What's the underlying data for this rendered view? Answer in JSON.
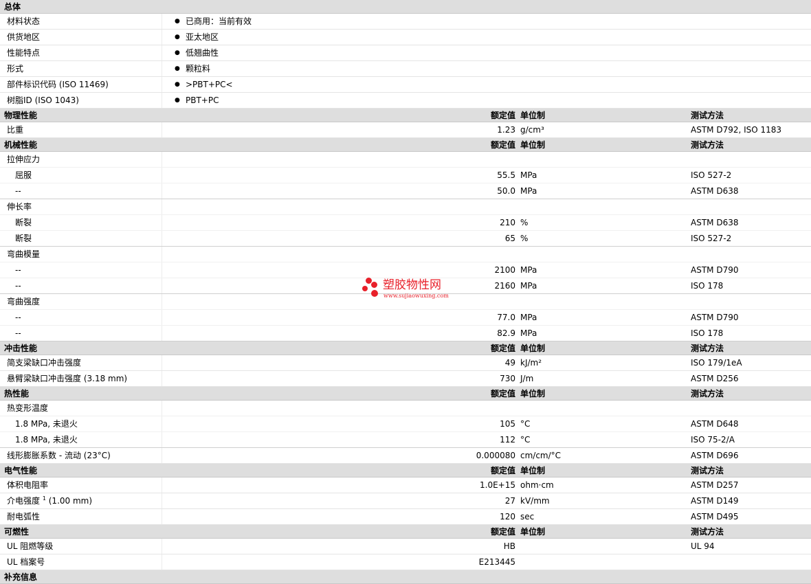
{
  "sections": {
    "general": {
      "title": "总体",
      "rows": [
        {
          "label": "材料状态",
          "value": "已商用：当前有效"
        },
        {
          "label": "供货地区",
          "value": "亚太地区"
        },
        {
          "label": "性能特点",
          "value": "低翘曲性"
        },
        {
          "label": "形式",
          "value": "颗粒料"
        },
        {
          "label": "部件标识代码  (ISO 11469)",
          "value": ">PBT+PC<"
        },
        {
          "label": "树脂ID (ISO 1043)",
          "value": "PBT+PC"
        }
      ]
    },
    "headers": {
      "nominal": "额定值",
      "unit": "单位制",
      "method": "测试方法"
    },
    "physical": {
      "title": "物理性能",
      "rows": [
        {
          "label": "比重",
          "nominal": "1.23",
          "unit": "g/cm³",
          "method": "ASTM D792, ISO 1183"
        }
      ]
    },
    "mechanical": {
      "title": "机械性能",
      "tensile": {
        "label": "拉伸应力",
        "rows": [
          {
            "label": "屈服",
            "nominal": "55.5",
            "unit": "MPa",
            "method": "ISO 527-2"
          },
          {
            "label": "--",
            "nominal": "50.0",
            "unit": "MPa",
            "method": "ASTM D638"
          }
        ]
      },
      "elongation": {
        "label": "伸长率",
        "rows": [
          {
            "label": "断裂",
            "nominal": "210",
            "unit": "%",
            "method": "ASTM D638"
          },
          {
            "label": "断裂",
            "nominal": "65",
            "unit": "%",
            "method": "ISO 527-2"
          }
        ]
      },
      "flex_modulus": {
        "label": "弯曲模量",
        "rows": [
          {
            "label": "--",
            "nominal": "2100",
            "unit": "MPa",
            "method": "ASTM D790"
          },
          {
            "label": "--",
            "nominal": "2160",
            "unit": "MPa",
            "method": "ISO 178"
          }
        ]
      },
      "flex_strength": {
        "label": "弯曲强度",
        "rows": [
          {
            "label": "--",
            "nominal": "77.0",
            "unit": "MPa",
            "method": "ASTM D790"
          },
          {
            "label": "--",
            "nominal": "82.9",
            "unit": "MPa",
            "method": "ISO 178"
          }
        ]
      }
    },
    "impact": {
      "title": "冲击性能",
      "rows": [
        {
          "label": "简支梁缺口冲击强度",
          "nominal": "49",
          "unit": "kJ/m²",
          "method": "ISO 179/1eA"
        },
        {
          "label": "悬臂梁缺口冲击强度  (3.18 mm)",
          "nominal": "730",
          "unit": "J/m",
          "method": "ASTM D256"
        }
      ]
    },
    "thermal": {
      "title": "热性能",
      "hdt": {
        "label": "热变形温度",
        "rows": [
          {
            "label": "1.8 MPa, 未退火",
            "nominal": "105",
            "unit": "°C",
            "method": "ASTM D648"
          },
          {
            "label": "1.8 MPa, 未退火",
            "nominal": "112",
            "unit": "°C",
            "method": "ISO 75-2/A"
          }
        ]
      },
      "clte": {
        "label": "线形膨胀系数  - 流动  (23°C)",
        "nominal": "0.000080",
        "unit": "cm/cm/°C",
        "method": "ASTM D696"
      }
    },
    "electrical": {
      "title": "电气性能",
      "volume_resistivity": {
        "label": "体积电阻率",
        "nominal": "1.0E+15",
        "unit": "ohm·cm",
        "method": "ASTM D257"
      },
      "dielectric": {
        "label": "介电强度",
        "sup": "1",
        "suffix": " (1.00 mm)",
        "nominal": "27",
        "unit": "kV/mm",
        "method": "ASTM D149"
      },
      "arc": {
        "label": "耐电弧性",
        "nominal": "120",
        "unit": "sec",
        "method": "ASTM D495"
      }
    },
    "flammability": {
      "title": "可燃性",
      "rows": [
        {
          "label": "UL 阻燃等级",
          "nominal": "HB",
          "unit": "",
          "method": "UL 94"
        },
        {
          "label": "UL 档案号",
          "nominal": "E213445",
          "unit": "",
          "method": ""
        }
      ]
    },
    "supplement": {
      "title": "补充信息"
    }
  },
  "watermark": {
    "text": "塑胶物性网",
    "url": "www.sujiaowuxing.com",
    "color": "#e8202a"
  },
  "colors": {
    "header_bg": "#dedede",
    "row_border": "#e4e4e4"
  }
}
